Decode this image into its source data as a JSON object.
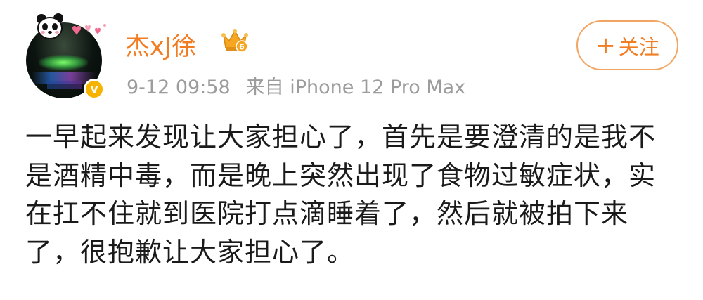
{
  "post": {
    "author": {
      "name": "杰xJ徐",
      "verified_badge": "v",
      "avatar_icon": "avatar-image",
      "crown_icon": "vip-crown-icon",
      "crown_level": "6"
    },
    "meta": {
      "timestamp": "9-12 09:58",
      "source": "来自 iPhone 12 Pro Max"
    },
    "follow_button": {
      "plus": "+",
      "label": "关注"
    },
    "content": "一早起来发现让大家担心了，首先是要澄清的是我不是酒精中毒，而是晚上突然出现了食物过敏症状，实在扛不住就到医院打点滴睡着了，然后就被拍下来了，很抱歉让大家担心了。"
  },
  "colors": {
    "accent": "#f27c22",
    "meta_gray": "#9c9c9c",
    "verified": "#f6b400",
    "follow_border": "#f2a562"
  }
}
